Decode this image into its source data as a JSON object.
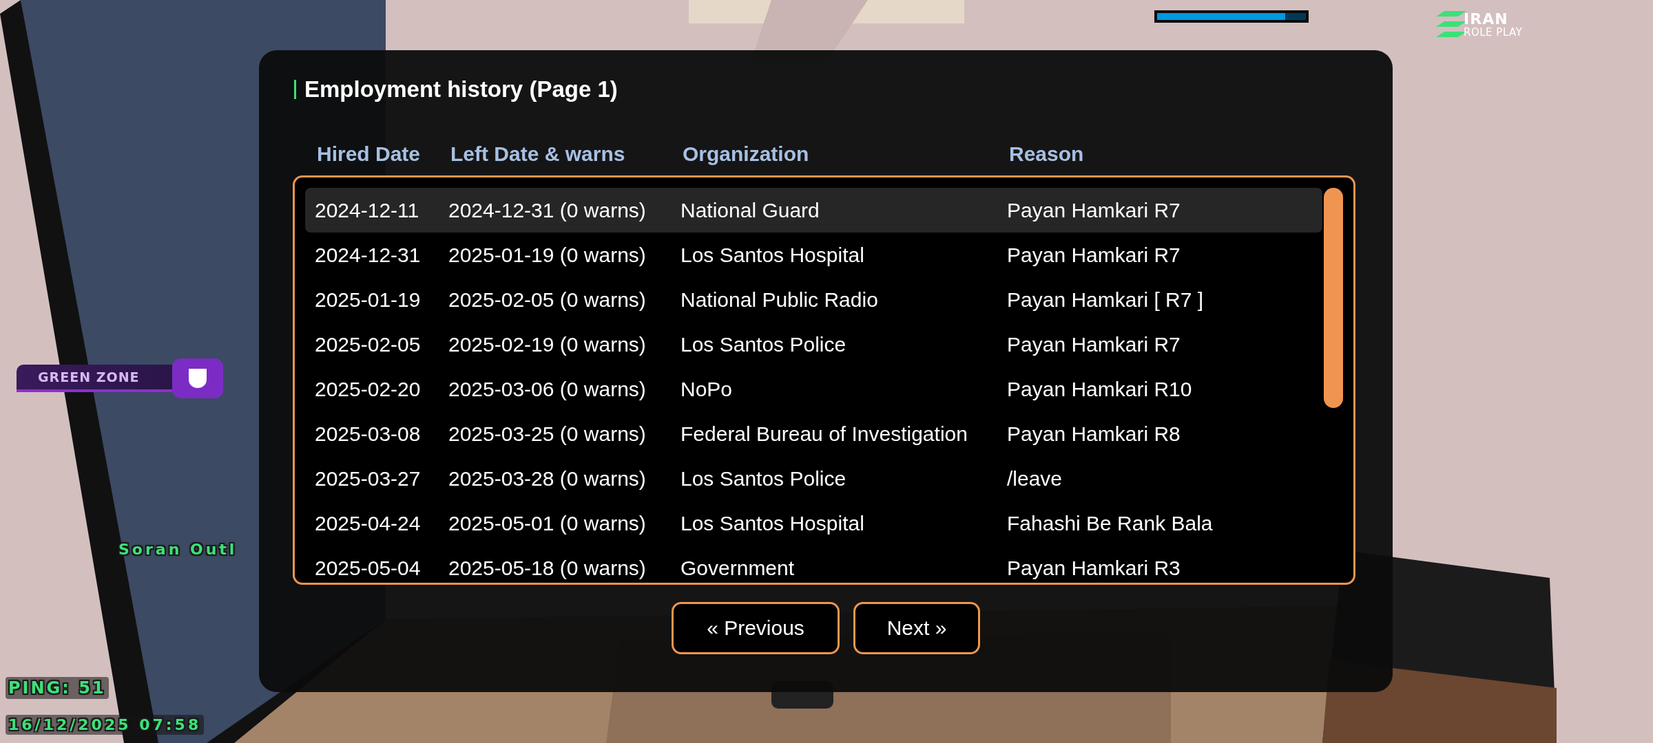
{
  "hud": {
    "health_bar": {
      "level": 0.86
    },
    "logo": {
      "line_1": "IRAN",
      "line_2": "ROLE PLAY"
    },
    "zone_badge": {
      "label": "GREEN ZONE"
    },
    "player_tag": "Soran Outl",
    "ping": "PING: 51",
    "datetime": "16/12/2025 07:58"
  },
  "dialog": {
    "title": "Employment history (Page 1)",
    "columns": [
      "Hired Date",
      "Left Date & warns",
      "Organization",
      "Reason"
    ],
    "rows": [
      {
        "cells": [
          "2024-12-11",
          "2024-12-31 (0 warns)",
          "National Guard",
          "Payan Hamkari R7"
        ],
        "selected": true
      },
      {
        "cells": [
          "2024-12-31",
          "2025-01-19 (0 warns)",
          "Los Santos Hospital",
          "Payan Hamkari R7"
        ],
        "selected": false
      },
      {
        "cells": [
          "2025-01-19",
          "2025-02-05 (0 warns)",
          "National Public Radio",
          "Payan Hamkari [ R7 ]"
        ],
        "selected": false
      },
      {
        "cells": [
          "2025-02-05",
          "2025-02-19 (0 warns)",
          "Los Santos Police",
          "Payan Hamkari R7"
        ],
        "selected": false
      },
      {
        "cells": [
          "2025-02-20",
          "2025-03-06 (0 warns)",
          "NoPo",
          "Payan Hamkari R10"
        ],
        "selected": false
      },
      {
        "cells": [
          "2025-03-08",
          "2025-03-25 (0 warns)",
          "Federal Bureau of Investigation",
          "Payan Hamkari R8"
        ],
        "selected": false
      },
      {
        "cells": [
          "2025-03-27",
          "2025-03-28 (0 warns)",
          "Los Santos Police",
          "/leave"
        ],
        "selected": false
      },
      {
        "cells": [
          "2025-04-24",
          "2025-05-01 (0 warns)",
          "Los Santos Hospital",
          "Fahashi Be Rank Bala"
        ],
        "selected": false
      },
      {
        "cells": [
          "2025-05-04",
          "2025-05-18 (0 warns)",
          "Government",
          "Payan Hamkari R3"
        ],
        "selected": false
      }
    ],
    "buttons": [
      "« Previous",
      "Next »"
    ]
  }
}
